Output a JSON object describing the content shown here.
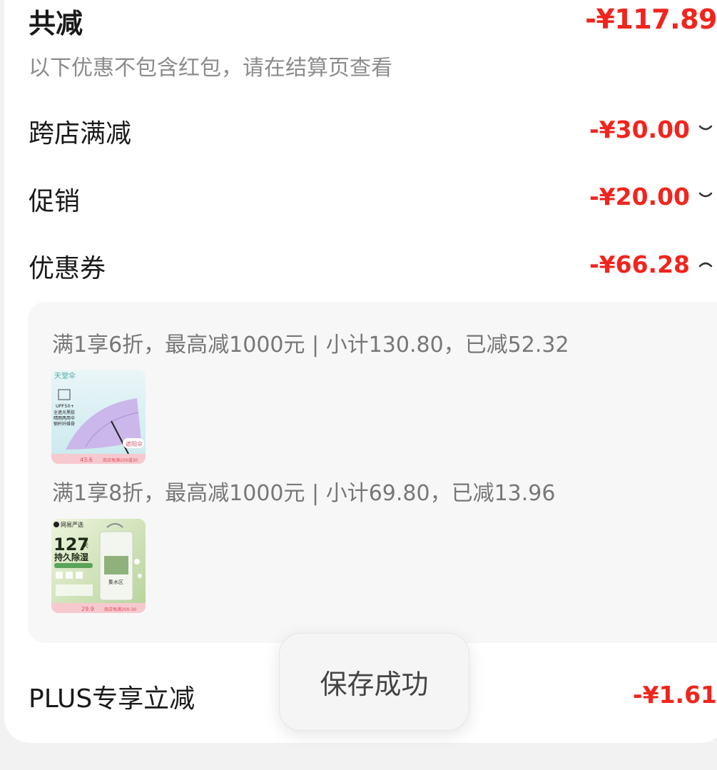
{
  "summary": {
    "title": "共减",
    "total": "-¥117.89",
    "note": "以下优惠不包含红包，请在结算页查看"
  },
  "rows": [
    {
      "label": "跨店满减",
      "amount": "-¥30.00",
      "expanded": false
    },
    {
      "label": "促销",
      "amount": "-¥20.00",
      "expanded": false
    },
    {
      "label": "优惠券",
      "amount": "-¥66.28",
      "expanded": true
    }
  ],
  "coupon_groups": [
    {
      "title": "满1享6折，最高减1000元 | 小计130.80，已减52.32",
      "product": {
        "image": "umbrella-product-image",
        "image_texts": [
          "天堂伞",
          "UPF50+",
          "全遮光黑胶",
          "晴雨两用伞",
          "钢杆纤维骨",
          "遮阳伞",
          "43.6",
          "商店每满200减30"
        ]
      }
    },
    {
      "title": "满1享8折，最高减1000元 | 小计69.80，已减13.96",
      "product": {
        "image": "dehumidifier-product-image",
        "image_texts": [
          "网易严选",
          "127",
          "天",
          "持久除湿",
          "集水区",
          "29.9",
          "商店每满200-30"
        ]
      }
    }
  ],
  "plus": {
    "label": "PLUS专享立减",
    "amount": "-¥1.61"
  },
  "toast": {
    "text": "保存成功"
  },
  "colors": {
    "accent": "#f0251e",
    "panel": "#f7f7f7",
    "muted": "#8c8c8c"
  },
  "icons": {
    "collapsed": "chevron-down-icon",
    "expanded": "chevron-up-icon"
  }
}
